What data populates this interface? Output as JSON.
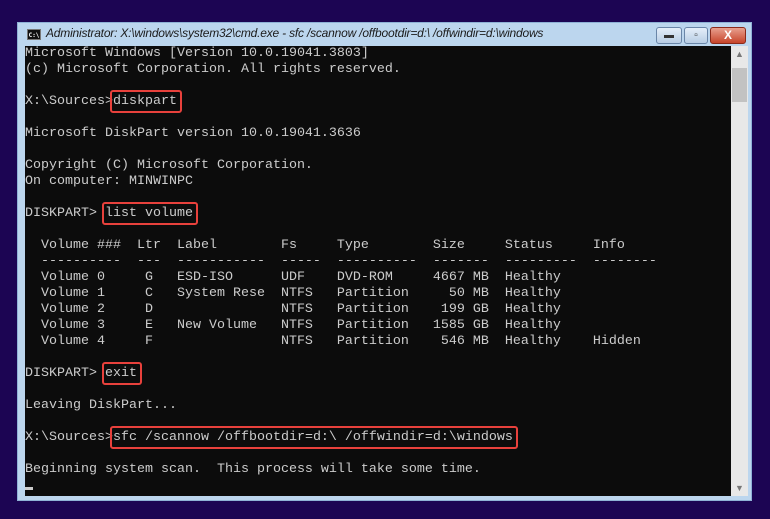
{
  "window": {
    "title": "Administrator: X:\\windows\\system32\\cmd.exe - sfc  /scannow /offbootdir=d:\\ /offwindir=d:\\windows",
    "icon": "cmd-icon",
    "buttons": {
      "minimize": "▬",
      "maximize": "▫",
      "close": "X"
    }
  },
  "accent_color": "#e8413c",
  "console": {
    "lines": [
      {
        "text": "Microsoft Windows [Version 10.0.19041.3803]"
      },
      {
        "text": "(c) Microsoft Corporation. All rights reserved."
      },
      {
        "text": ""
      },
      {
        "text": "X:\\Sources>",
        "cmd": "diskpart"
      },
      {
        "text": ""
      },
      {
        "text": "Microsoft DiskPart version 10.0.19041.3636"
      },
      {
        "text": ""
      },
      {
        "text": "Copyright (C) Microsoft Corporation."
      },
      {
        "text": "On computer: MINWINPC"
      },
      {
        "text": ""
      },
      {
        "text": "DISKPART> ",
        "cmd": "list volume"
      },
      {
        "text": ""
      },
      {
        "text": "  Volume ###  Ltr  Label        Fs     Type        Size     Status     Info"
      },
      {
        "text": "  ----------  ---  -----------  -----  ----------  -------  ---------  --------"
      },
      {
        "text": "  Volume 0     G   ESD-ISO      UDF    DVD-ROM     4667 MB  Healthy"
      },
      {
        "text": "  Volume 1     C   System Rese  NTFS   Partition     50 MB  Healthy"
      },
      {
        "text": "  Volume 2     D                NTFS   Partition    199 GB  Healthy"
      },
      {
        "text": "  Volume 3     E   New Volume   NTFS   Partition   1585 GB  Healthy"
      },
      {
        "text": "  Volume 4     F                NTFS   Partition    546 MB  Healthy    Hidden"
      },
      {
        "text": ""
      },
      {
        "text": "DISKPART> ",
        "cmd": "exit"
      },
      {
        "text": ""
      },
      {
        "text": "Leaving DiskPart..."
      },
      {
        "text": ""
      },
      {
        "text": "X:\\Sources>",
        "cmd": "sfc /scannow /offbootdir=d:\\ /offwindir=d:\\windows"
      },
      {
        "text": ""
      },
      {
        "text": "Beginning system scan.  This process will take some time."
      },
      {
        "text": "",
        "cursor": true
      }
    ]
  }
}
